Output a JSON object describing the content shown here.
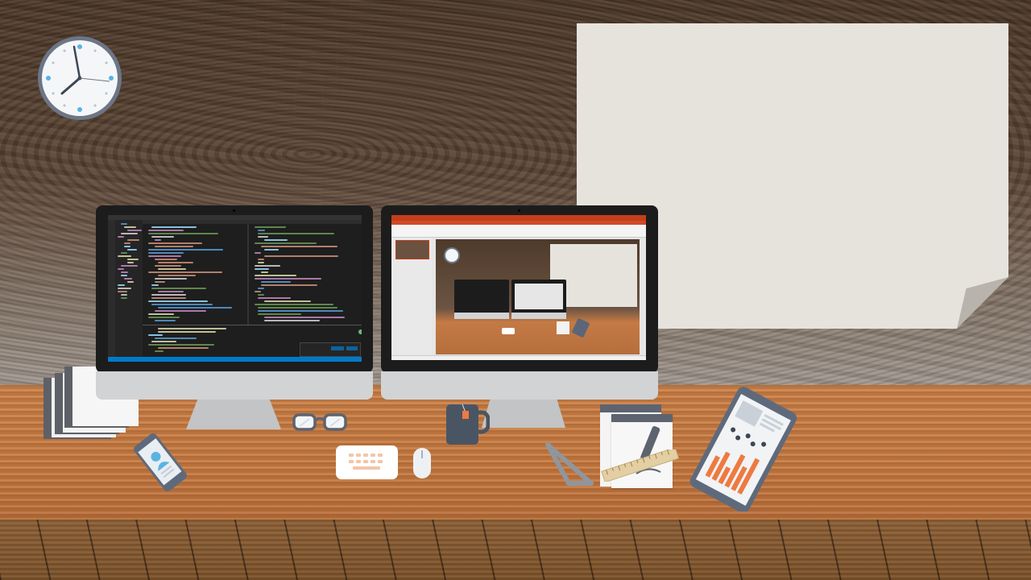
{
  "scene": {
    "colors": {
      "wall": "#5b4433",
      "desk": "#c47a44",
      "floor": "#7a5029",
      "paper": "#e6e3dd",
      "monitor_bezel": "#1c1c1c",
      "monitor_chin": "#d2d3d4",
      "accent_blue": "#007acc",
      "accent_red": "#c43e1c",
      "chart_orange": "#ee7a41"
    },
    "icons": {
      "clock": "wall-clock-icon",
      "glasses": "glasses-icon",
      "keyboard": "keyboard-icon",
      "mouse": "mouse-icon",
      "mug": "mug-icon",
      "phone": "phone-icon",
      "tablet": "tablet-chart-icon",
      "notepad": "notepad-pen-icon",
      "ruler": "ruler-icon",
      "set_square": "set-square-icon",
      "papers": "paper-stack-icon"
    }
  }
}
